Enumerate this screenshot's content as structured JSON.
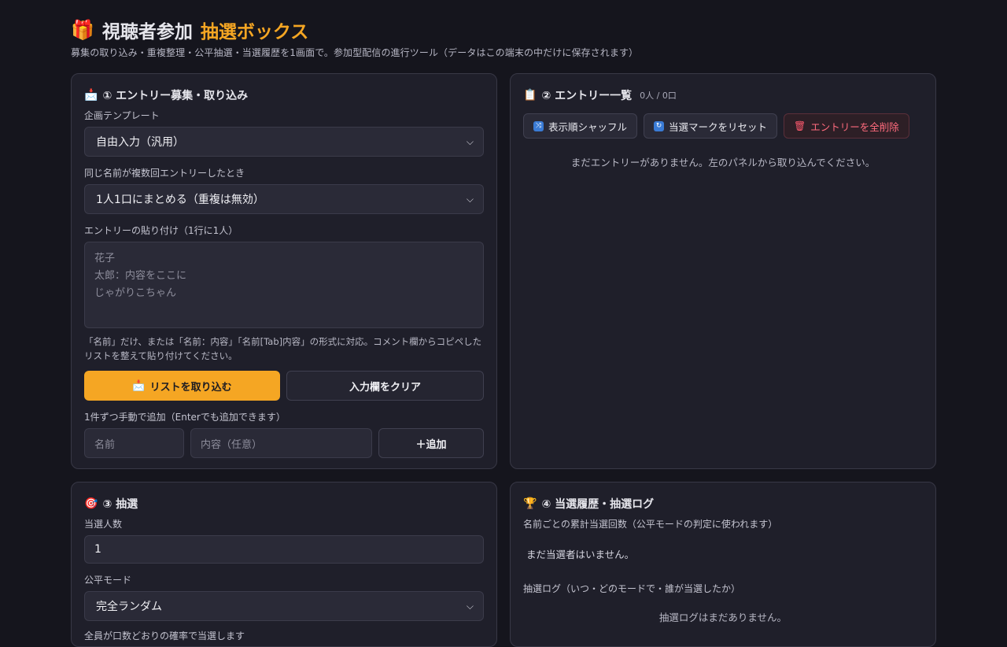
{
  "header": {
    "title_main": "視聴者参加",
    "title_accent": "抽選ボックス",
    "subtitle": "募集の取り込み・重複整理・公平抽選・当選履歴を1画面で。参加型配信の進行ツール（データはこの端末の中だけに保存されます）"
  },
  "panel_entry": {
    "title": "① エントリー募集・取り込み",
    "template_label": "企画テンプレート",
    "template_value": "自由入力（汎用）",
    "dup_label": "同じ名前が複数回エントリーしたとき",
    "dup_value": "1人1口にまとめる（重複は無効）",
    "paste_label": "エントリーの貼り付け（1行に1人）",
    "paste_placeholder_lines": [
      "花子",
      "太郎：内容をここに",
      "じゃがりこちゃん"
    ],
    "hint": "「名前」だけ、または「名前：内容」「名前[Tab]内容」の形式に対応。コメント欄からコピペしたリストを整えて貼り付けてください。",
    "import_button": "リストを取り込む",
    "clear_button": "入力欄をクリア",
    "manual_label": "1件ずつ手動で追加（Enterでも追加できます）",
    "name_placeholder": "名前",
    "content_placeholder": "内容（任意）",
    "add_button": "＋追加"
  },
  "panel_list": {
    "title": "② エントリー一覧",
    "count": "0人 / 0口",
    "shuffle_button": "表示順シャッフル",
    "reset_button": "当選マークをリセット",
    "delete_button": "エントリーを全削除",
    "empty_text": "まだエントリーがありません。左のパネルから取り込んでください。"
  },
  "panel_draw": {
    "title": "③ 抽選",
    "winners_label": "当選人数",
    "winners_value": "1",
    "mode_label": "公平モード",
    "mode_value": "完全ランダム",
    "mode_note": "全員が口数どおりの確率で当選します"
  },
  "panel_history": {
    "title": "④ 当選履歴・抽選ログ",
    "tally_label": "名前ごとの累計当選回数（公平モードの判定に使われます）",
    "tally_empty": "まだ当選者はいません。",
    "log_label": "抽選ログ（いつ・どのモードで・誰が当選したか）",
    "log_empty": "抽選ログはまだありません。"
  },
  "icons": {
    "gift": "🎁",
    "inbox": "📩",
    "clipboard": "📋",
    "target": "🎯",
    "trophy": "🏆"
  },
  "colors": {
    "accent": "#f5a623",
    "background": "#15151d",
    "panel": "#1f1f2a",
    "danger": "#ff6b7d"
  }
}
